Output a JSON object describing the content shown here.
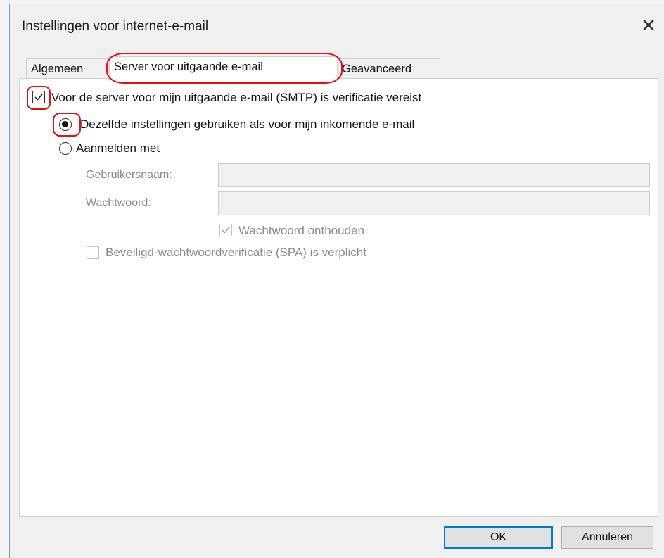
{
  "dialog": {
    "title": "Instellingen voor internet-e-mail",
    "close_glyph": "✕"
  },
  "tabs": [
    {
      "label": "Algemeen",
      "active": false
    },
    {
      "label": "Server voor uitgaande e-mail",
      "active": true
    },
    {
      "label": "Geavanceerd",
      "active": false
    }
  ],
  "smtp": {
    "auth_required_label": "Voor de server voor mijn uitgaande e-mail (SMTP) is verificatie vereist",
    "auth_required_checked": true,
    "same_settings_label": "Dezelfde instellingen gebruiken als voor mijn inkomende e-mail",
    "same_settings_selected": true,
    "login_with_label": "Aanmelden met",
    "login_with_selected": false,
    "username_label": "Gebruikersnaam:",
    "username_value": "",
    "password_label": "Wachtwoord:",
    "password_value": "",
    "remember_password_label": "Wachtwoord onthouden",
    "remember_password_checked": true,
    "spa_label": "Beveiligd-wachtwoordverificatie (SPA) is verplicht",
    "spa_checked": false
  },
  "buttons": {
    "ok": "OK",
    "cancel": "Annuleren"
  },
  "colors": {
    "annotation_red": "#e81010",
    "default_button_border": "#0078d7"
  }
}
